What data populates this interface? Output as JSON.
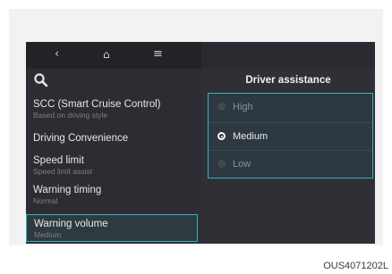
{
  "topbar": {
    "back_icon": "back-chevron-icon",
    "home_icon": "home-icon",
    "menu_icon": "menu-icon"
  },
  "search_icon": "search-icon",
  "menu": [
    {
      "title": "SCC (Smart Cruise Control)",
      "subtitle": "Based on driving style"
    },
    {
      "title": "Driving Convenience",
      "subtitle": ""
    },
    {
      "title": "Speed limit",
      "subtitle": "Speed limit assist"
    },
    {
      "title": "Warning timing",
      "subtitle": "Normal"
    },
    {
      "title": "Warning volume",
      "subtitle": "Medium"
    }
  ],
  "panel": {
    "title": "Driver assistance",
    "options": [
      {
        "label": "High",
        "selected": false
      },
      {
        "label": "Medium",
        "selected": true
      },
      {
        "label": "Low",
        "selected": false
      }
    ]
  },
  "figure_code": "OUS4071202L",
  "colors": {
    "accent": "#2fb5c6",
    "screen_bg": "#2f2f35"
  }
}
